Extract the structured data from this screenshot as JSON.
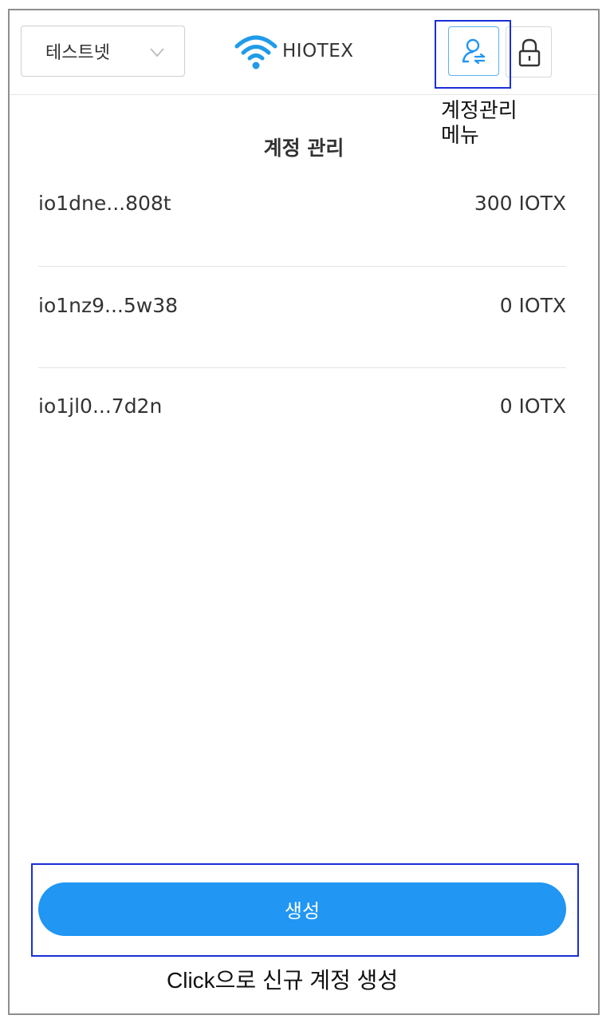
{
  "header": {
    "network_label": "테스트넷",
    "logo_text": "HIOTEX",
    "account_icon": "account-switch-icon",
    "lock_icon": "lock-icon"
  },
  "annotations": {
    "account_menu_line1": "계정관리",
    "account_menu_line2": "메뉴",
    "create_hint": "Click으로 신규 계정 생성"
  },
  "main": {
    "title": "계정 관리",
    "accounts": [
      {
        "address": "io1dne...808t",
        "balance": "300 IOTX"
      },
      {
        "address": "io1nz9...5w38",
        "balance": "0 IOTX"
      },
      {
        "address": "io1jl0...7d2n",
        "balance": "0 IOTX"
      }
    ],
    "create_label": "생성"
  },
  "colors": {
    "accent": "#2196f3",
    "highlight": "#1a2fd6",
    "logo_blue": "#1f9be8"
  }
}
